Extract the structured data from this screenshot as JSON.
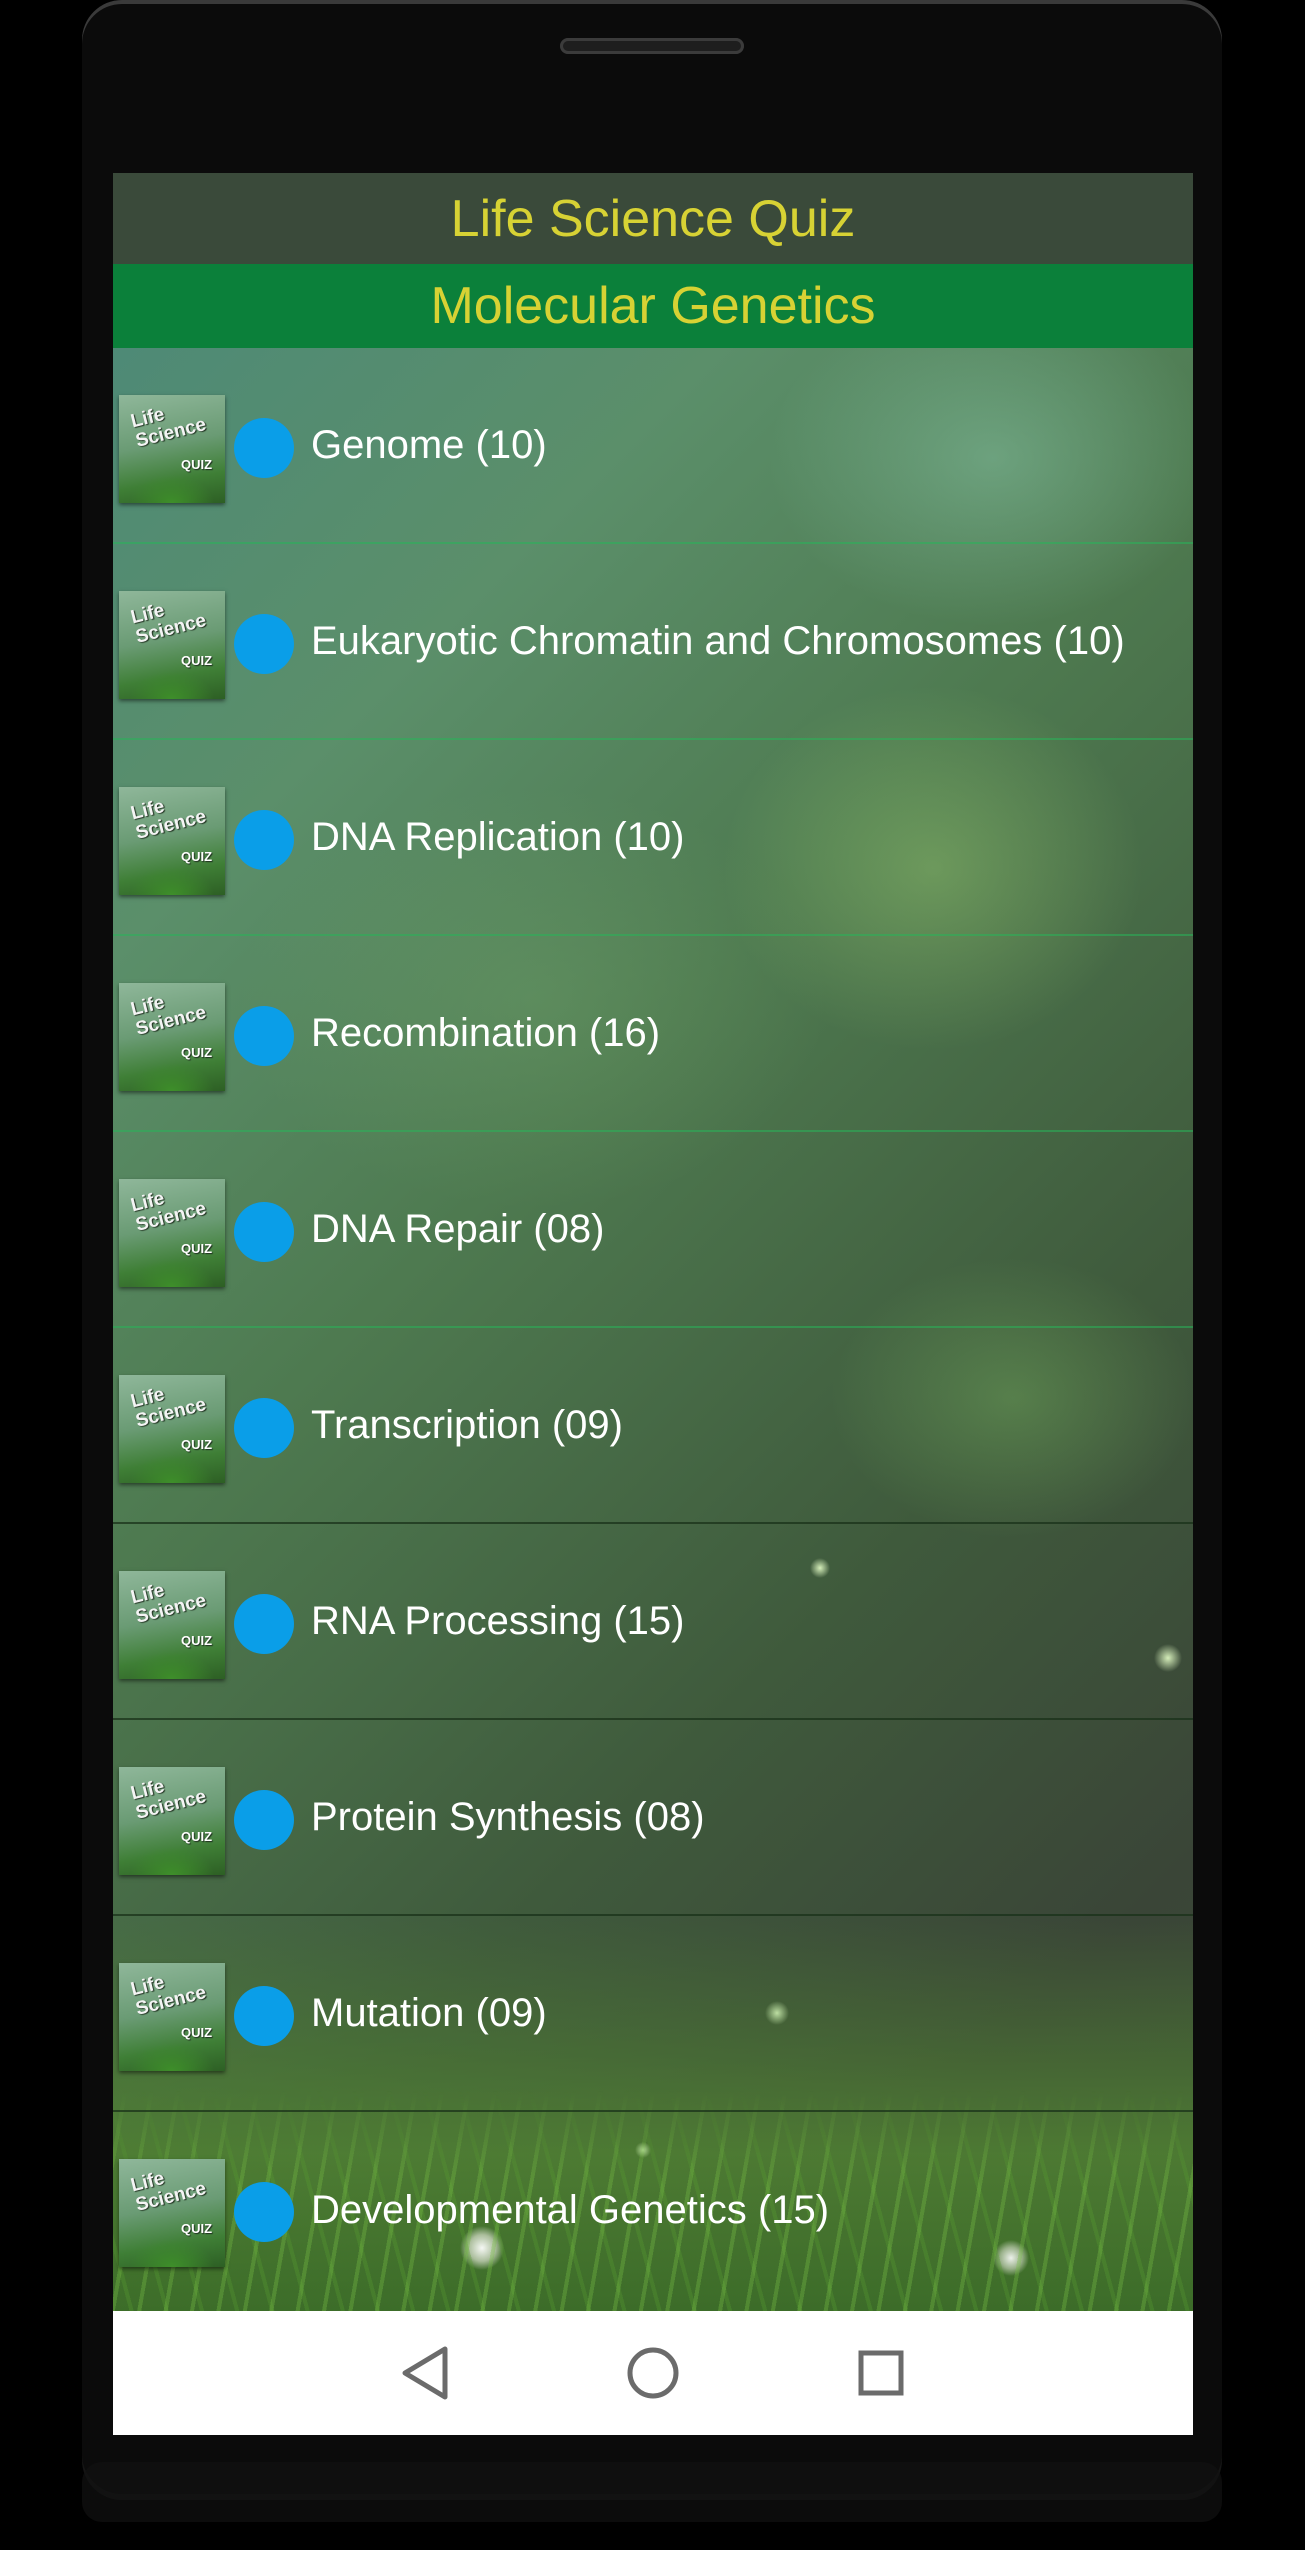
{
  "app": {
    "title": "Life Science Quiz",
    "section": "Molecular Genetics"
  },
  "thumbnail": {
    "line1": "Life",
    "line2": "Science",
    "line3": "QUIZ"
  },
  "topics": [
    {
      "label": "Genome (10)"
    },
    {
      "label": "Eukaryotic Chromatin and Chromosomes (10)"
    },
    {
      "label": "DNA Replication (10)"
    },
    {
      "label": "Recombination (16)"
    },
    {
      "label": "DNA Repair (08)"
    },
    {
      "label": "Transcription (09)"
    },
    {
      "label": "RNA Processing (15)"
    },
    {
      "label": "Protein Synthesis (08)"
    },
    {
      "label": "Mutation (09)"
    },
    {
      "label": "Developmental Genetics (15)"
    }
  ],
  "navigation": {
    "back": "back-icon",
    "home": "home-icon",
    "recents": "recents-icon"
  },
  "colors": {
    "title_yellow": "#d7d234",
    "section_green": "#0b803a",
    "dot_blue": "#0a9ee8"
  }
}
